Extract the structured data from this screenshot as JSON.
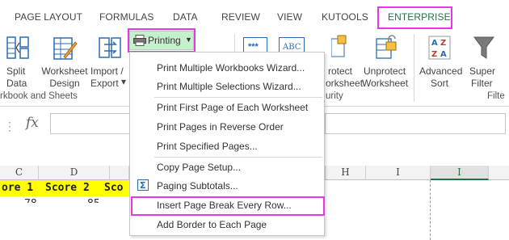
{
  "colors": {
    "accent": "#217346",
    "highlight": "#e835e8",
    "printing_bg": "#c6efce",
    "score_row": "#ffff00"
  },
  "tabs": [
    "PAGE LAYOUT",
    "FORMULAS",
    "DATA",
    "REVIEW",
    "VIEW",
    "KUTOOLS",
    "ENTERPRISE"
  ],
  "active_tab": "ENTERPRISE",
  "ribbon": {
    "split": [
      "Split",
      "Data"
    ],
    "worksheet_design": [
      "Worksheet",
      "Design"
    ],
    "import_export": [
      "Import /",
      "Export"
    ],
    "printing_label": "Printing",
    "protect": [
      "rotect",
      "orksheet"
    ],
    "unprotect": [
      "Unprotect",
      "Worksheet"
    ],
    "advanced_sort": [
      "Advanced",
      "Sort"
    ],
    "super_filter": [
      "Super",
      "Filter"
    ],
    "group_workbook": "rkbook and Sheets",
    "group_security": "urity",
    "group_filter": "Filte",
    "icon_text_1": "***",
    "icon_text_2": "ABC"
  },
  "formula_bar": {
    "fx": "fx"
  },
  "grid": {
    "col_headers": [
      "C",
      "D",
      "",
      "H",
      "I",
      ""
    ],
    "row1": [
      "ore 1",
      "Score 2",
      "Sco"
    ],
    "row2": [
      "78",
      "85"
    ]
  },
  "menu": {
    "items": [
      "Print Multiple Workbooks Wizard...",
      "Print Multiple Selections Wizard...",
      "Print First Page of Each Worksheet",
      "Print Pages in Reverse Order",
      "Print Specified Pages...",
      "Copy Page Setup...",
      "Paging Subtotals...",
      "Insert Page Break Every Row...",
      "Add Border to Each Page"
    ]
  }
}
